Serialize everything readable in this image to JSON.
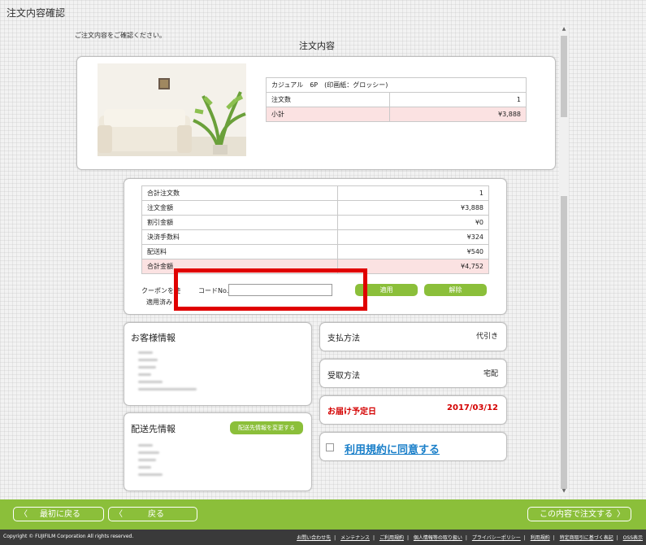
{
  "page": {
    "title": "注文内容確認",
    "instruction": "ご注文内容をご確認ください。",
    "section_title": "注文内容"
  },
  "product": {
    "name": "カジュアル　6P　(印画紙：グロッシー)",
    "qty_label": "注文数",
    "qty_value": "1",
    "subtotal_label": "小計",
    "subtotal_value": "¥3,888"
  },
  "totals": {
    "rows": [
      {
        "label": "合計注文数",
        "value": "1"
      },
      {
        "label": "注文金額",
        "value": "¥3,888"
      },
      {
        "label": "割引金額",
        "value": "¥0"
      },
      {
        "label": "決済手数料",
        "value": "¥324"
      },
      {
        "label": "配送料",
        "value": "¥540"
      },
      {
        "label": "合計金額",
        "value": "¥4,752"
      }
    ]
  },
  "coupon": {
    "label": "クーポンを使",
    "applied_label": "適用済み",
    "code_label": "コードNo.",
    "code_value": "",
    "apply_button": "適用",
    "remove_button": "解除"
  },
  "customer": {
    "title": "お客様情報"
  },
  "shipping": {
    "title": "配送先情報",
    "change_button": "配送先情報を変更する"
  },
  "payment": {
    "label": "支払方法",
    "value": "代引き"
  },
  "receive": {
    "label": "受取方法",
    "value": "宅配"
  },
  "delivery": {
    "label": "お届け予定日",
    "value": "2017/03/12",
    "color": "#d40000"
  },
  "terms": {
    "label": "利用規約に同意する",
    "color": "#1a7fc9"
  },
  "nav": {
    "first": "最初に戻る",
    "back": "戻る",
    "order": "この内容で注文する",
    "accent": "#8bbf3a"
  },
  "footer": {
    "copyright": "Copyright © FUJIFILM Corporation All rights reserved.",
    "links": [
      "お問い合わせ先",
      "メンテナンス",
      "ご利用規約",
      "個人情報等の取り扱い",
      "プライバシーポリシー",
      "利用規約",
      "特定商取引に基づく表記",
      "OSS表示"
    ]
  }
}
